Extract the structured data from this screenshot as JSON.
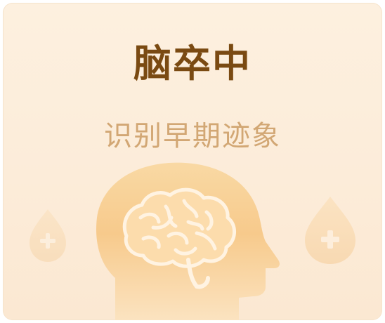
{
  "card": {
    "title": "脑卒中",
    "subtitle": "识别早期迹象"
  },
  "icons": {
    "illustration": "head-with-brain-icon",
    "left_drop": "blood-drop-plus-icon",
    "right_drop": "blood-drop-plus-icon"
  },
  "colors": {
    "title": "#7a4a12",
    "subtitle": "#d2a774",
    "background": "#fdf0df",
    "head": "#f7c98a"
  }
}
